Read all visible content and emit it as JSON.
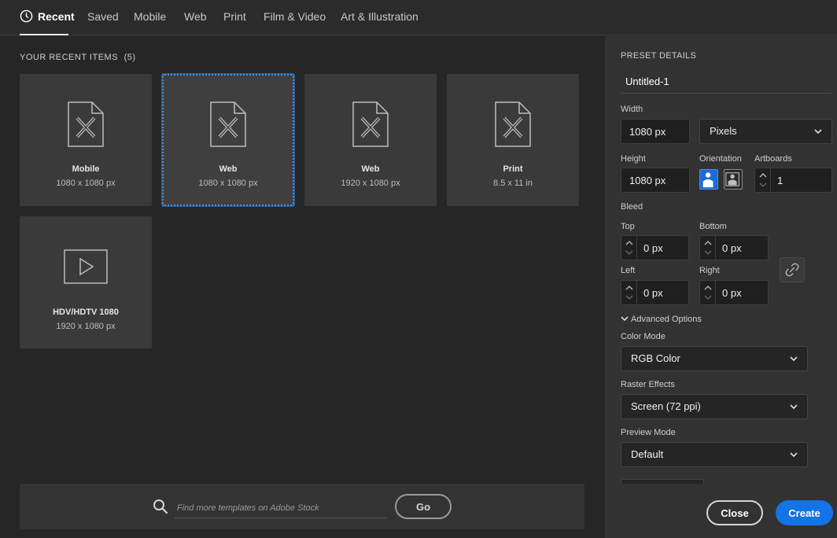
{
  "tabs": [
    {
      "label": "Recent",
      "active": true
    },
    {
      "label": "Saved"
    },
    {
      "label": "Mobile"
    },
    {
      "label": "Web"
    },
    {
      "label": "Print"
    },
    {
      "label": "Film & Video"
    },
    {
      "label": "Art & Illustration"
    }
  ],
  "recent": {
    "heading": "YOUR RECENT ITEMS",
    "count": "(5)",
    "items": [
      {
        "name": "Mobile",
        "size": "1080 x 1080 px",
        "icon": "document-icon"
      },
      {
        "name": "Web",
        "size": "1080 x 1080 px",
        "icon": "document-icon",
        "selected": true
      },
      {
        "name": "Web",
        "size": "1920 x 1080 px",
        "icon": "document-icon"
      },
      {
        "name": "Print",
        "size": "8.5 x 11 in",
        "icon": "document-icon"
      },
      {
        "name": "HDV/HDTV 1080",
        "size": "1920 x 1080 px",
        "icon": "video-icon"
      }
    ]
  },
  "search": {
    "placeholder": "Find more templates on Adobe Stock",
    "go_label": "Go"
  },
  "preset": {
    "heading": "PRESET DETAILS",
    "name": "Untitled-1",
    "width_label": "Width",
    "width_value": "1080 px",
    "units": "Pixels",
    "height_label": "Height",
    "height_value": "1080 px",
    "orientation_label": "Orientation",
    "artboards_label": "Artboards",
    "artboards_value": "1",
    "bleed_label": "Bleed",
    "top_label": "Top",
    "top_value": "0 px",
    "bottom_label": "Bottom",
    "bottom_value": "0 px",
    "left_label": "Left",
    "left_value": "0 px",
    "right_label": "Right",
    "right_value": "0 px",
    "advanced_label": "Advanced Options",
    "color_mode_label": "Color Mode",
    "color_mode_value": "RGB Color",
    "raster_label": "Raster Effects",
    "raster_value": "Screen (72 ppi)",
    "preview_label": "Preview Mode",
    "preview_value": "Default"
  },
  "actions": {
    "close_label": "Close",
    "create_label": "Create"
  },
  "colors": {
    "accent": "#1473e6",
    "selected_outline": "#4a90e2"
  }
}
